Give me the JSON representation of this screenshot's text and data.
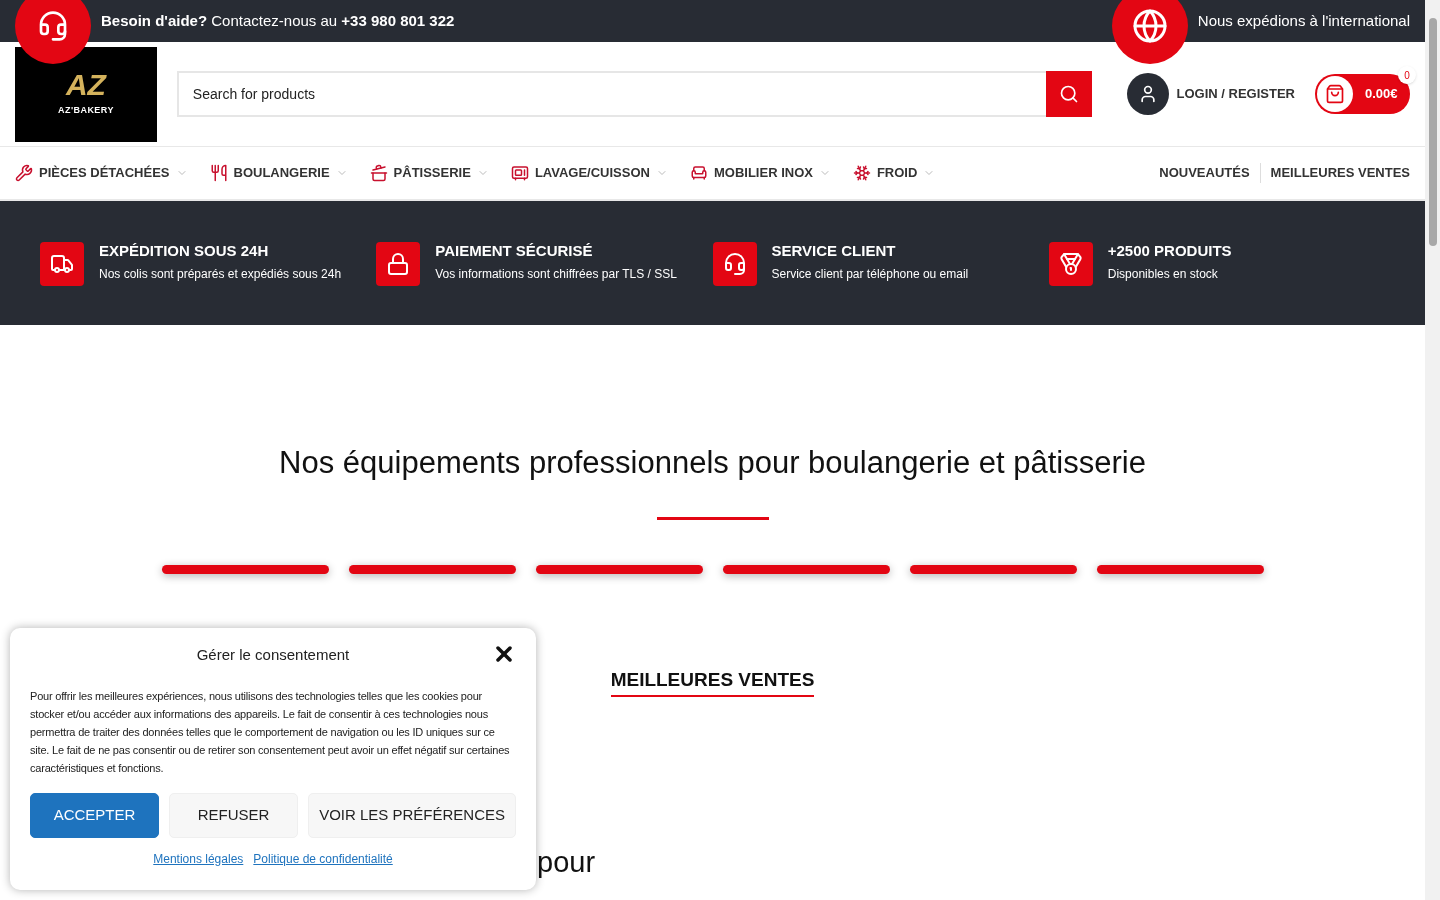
{
  "top_bar": {
    "help": "**Besoin d'aide?** Contactez-nous au **+33 980 801 322**",
    "shipping": "Nous expédions à l'international"
  },
  "header": {
    "logo_mark": "AZ",
    "logo_text": "AZ'BAKERY",
    "search": {
      "placeholder": "Search for products"
    },
    "login": "LOGIN / REGISTER",
    "cart": {
      "total": "0.00€",
      "count": "0"
    }
  },
  "nav": {
    "categories": [
      {
        "label": "PIÈCES DÉTACHÉES",
        "has_submenu": true
      },
      {
        "label": "BOULANGERIE",
        "has_submenu": true
      },
      {
        "label": "PÂTISSERIE",
        "has_submenu": true
      },
      {
        "label": "LAVAGE/CUISSON",
        "has_submenu": true
      },
      {
        "label": "MOBILIER INOX",
        "has_submenu": true
      },
      {
        "label": "FROID",
        "has_submenu": true
      }
    ],
    "links": [
      "NOUVEAUTÉS",
      "MEILLEURES VENTES"
    ]
  },
  "features": [
    {
      "title": "EXPÉDITION SOUS 24H",
      "text": "Nos colis sont préparés et expédiés sous 24h"
    },
    {
      "title": "PAIEMENT SÉCURISÉ",
      "text": "Vos informations sont chiffrées par TLS / SSL"
    },
    {
      "title": "SERVICE CLIENT",
      "text": "Service client par téléphone ou email"
    },
    {
      "title": "+2500 PRODUITS",
      "text": "Disponibles en stock"
    }
  ],
  "section": {
    "title": "Nos équipements professionnels pour boulangerie et pâtisserie",
    "tabs": [
      {
        "label": "MEILLEURES VENTES",
        "selected": true
      }
    ]
  },
  "next_heading": {
    "line_1": "pour"
  },
  "consent": {
    "title": "Gérer le consentement",
    "text": "Pour offrir les meilleures expériences, nous utilisons des technologies telles que les cookies pour stocker et/ou accéder aux informations des appareils. Le fait de consentir à ces technologies nous permettra de traiter des données telles que le comportement de navigation ou les ID uniques sur ce site. Le fait de ne pas consentir ou de retirer son consentement peut avoir un effet négatif sur certaines caractéristiques et fonctions.",
    "buttons": [
      {
        "label": "ACCEPTER",
        "kind": "primary"
      },
      {
        "label": "REFUSER",
        "kind": "secondary"
      },
      {
        "label": "VOIR LES PRÉFÉRENCES",
        "kind": "secondary"
      }
    ],
    "links": [
      "Mentions légales",
      "Politique de confidentialité"
    ]
  }
}
